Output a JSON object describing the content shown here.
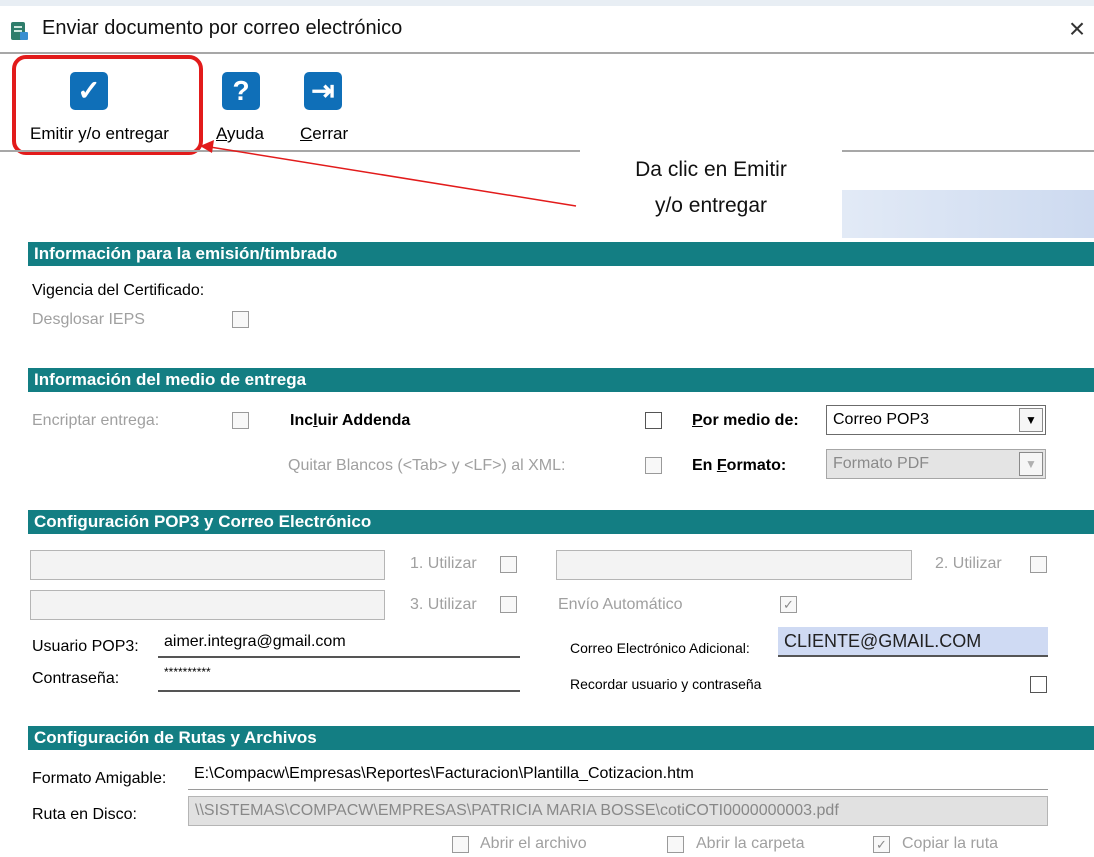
{
  "window": {
    "title": "Enviar documento por correo electrónico",
    "close_glyph": "×"
  },
  "toolbar": {
    "emitir": {
      "icon": "✓",
      "label_pre": "Emitir y/o entre",
      "label_u": "g",
      "label_post": "ar"
    },
    "ayuda": {
      "icon": "?",
      "label_pre": "",
      "label_u": "A",
      "label_post": "yuda"
    },
    "cerrar": {
      "icon": "⇥",
      "label_pre": "",
      "label_u": "C",
      "label_post": "errar"
    }
  },
  "callout": {
    "text_line1": "Da clic en Emitir",
    "text_line2": "y/o entregar"
  },
  "section_emision": {
    "header": "Información para la emisión/timbrado",
    "vigencia_label": "Vigencia del Certificado:",
    "desglosar_label": "Desglosar IEPS"
  },
  "section_entrega": {
    "header": "Información del medio de entrega",
    "encriptar_label": "Encriptar entrega:",
    "incluir_label_pre": "Inc",
    "incluir_label_u": "l",
    "incluir_label_post": "uir Addenda",
    "quitar_label": "Quitar Blancos (<Tab> y <LF>) al XML:",
    "medio_label_u": "P",
    "medio_label_post": "or medio de:",
    "medio_value": "Correo POP3",
    "formato_label_pre": "En ",
    "formato_label_u": "F",
    "formato_label_post": "ormato:",
    "formato_value": "Formato PDF"
  },
  "section_pop3": {
    "header": "Configuración POP3 y Correo Electrónico",
    "utilizar1": "1. Utilizar",
    "utilizar2": "2. Utilizar",
    "utilizar3": "3. Utilizar",
    "envio_label": "Envío Automático",
    "envio_checked": "✓",
    "usuario_label": "Usuario POP3:",
    "usuario_value": "aimer.integra@gmail.com",
    "contrasena_label": "Contraseña:",
    "contrasena_value": "**********",
    "correo_adicional_label": "Correo Electrónico Adicional:",
    "correo_adicional_value": "CLIENTE@GMAIL.COM",
    "recordar_label": "Recordar usuario y contraseña"
  },
  "section_rutas": {
    "header": "Configuración de Rutas y Archivos",
    "formato_label": "Formato Amigable:",
    "formato_value": "E:\\Compacw\\Empresas\\Reportes\\Facturacion\\Plantilla_Cotizacion.htm",
    "ruta_label": "Ruta en Disco:",
    "ruta_value": "\\\\SISTEMAS\\COMPACW\\EMPRESAS\\PATRICIA MARIA BOSSE\\cotiCOTI0000000003.pdf",
    "abrir_archivo": "Abrir el archivo",
    "abrir_carpeta": "Abrir la carpeta",
    "copiar_ruta": "Copiar la ruta",
    "copiar_checked": "✓"
  },
  "colors": {
    "section_header": "#137e83",
    "accent_blue": "#0f6fb8",
    "highlight_red": "#e21b1b"
  }
}
